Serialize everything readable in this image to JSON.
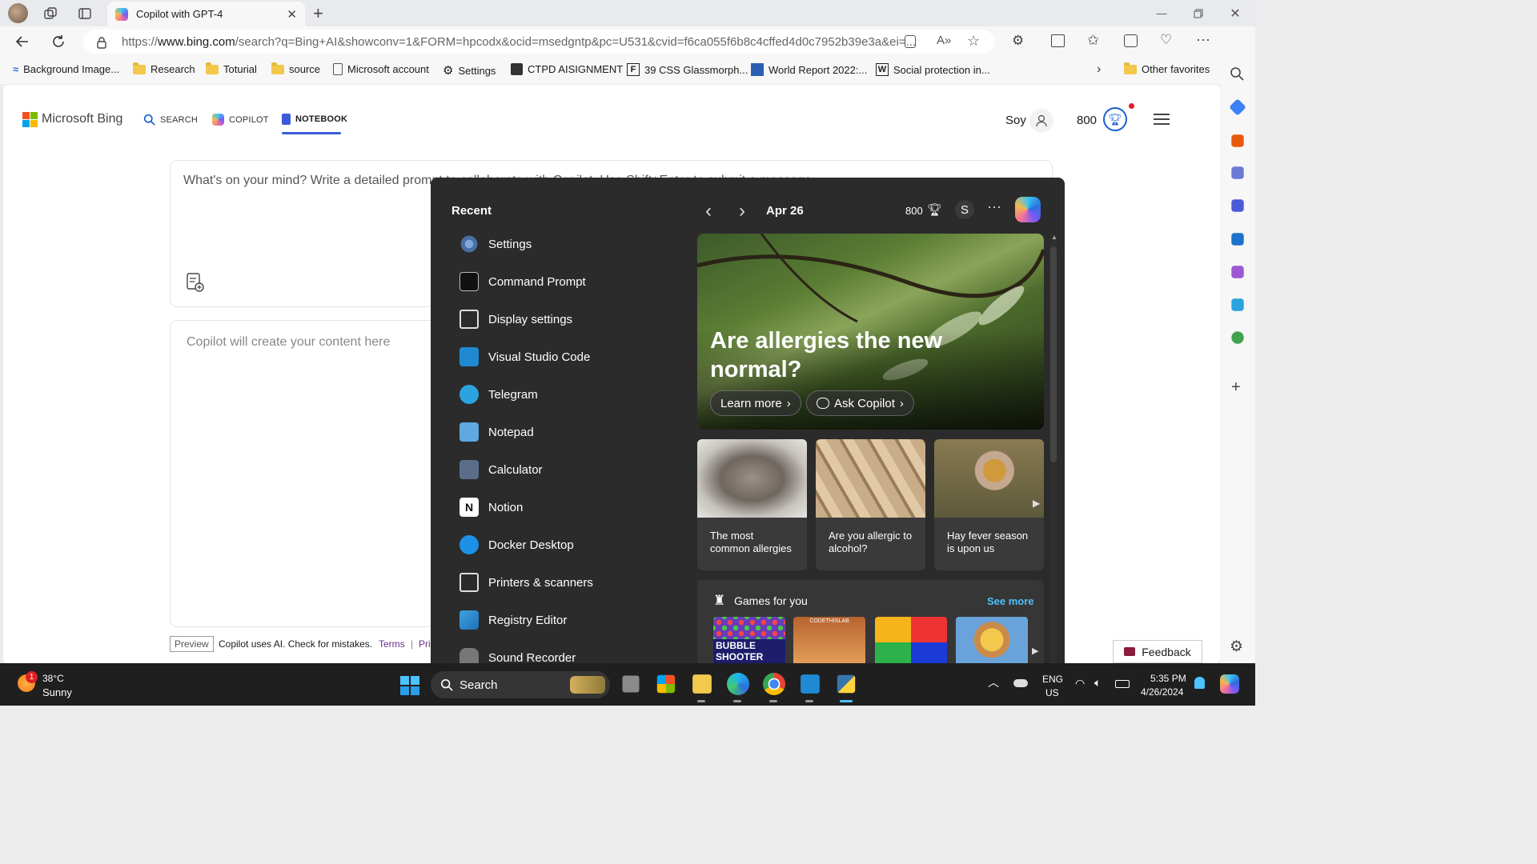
{
  "browser": {
    "tab_title": "Copilot with GPT-4",
    "url_prefix": "https://",
    "url_domain": "www.bing.com",
    "url_rest": "/search?q=Bing+AI&showconv=1&FORM=hpcodx&ocid=msedgntp&pc=U531&cvid=f6ca055f6b8c4cffed4d0c7952b39e3a&ei=...",
    "favorites": [
      "Background Image...",
      "Research",
      "Toturial",
      "source",
      "Microsoft account",
      "Settings",
      "CTPD AISIGNMENT",
      "39 CSS Glassmorph...",
      "World Report 2022:...",
      "Social protection in..."
    ],
    "other_favorites": "Other favorites"
  },
  "bing": {
    "logo": "Microsoft Bing",
    "nav": [
      "SEARCH",
      "COPILOT",
      "NOTEBOOK"
    ],
    "user": "Soy",
    "points": "800",
    "prompt_placeholder": "What's on your mind? Write a detailed prompt to collaborate with Copilot. Use Shift+Enter to submit a message.",
    "output_placeholder": "Copilot will create your content here",
    "preview": "Preview",
    "disclaimer": "Copilot uses AI. Check for mistakes.",
    "terms": "Terms",
    "privacy": "Pri",
    "feedback": "Feedback"
  },
  "start_menu": {
    "recent_label": "Recent",
    "date": "Apr 26",
    "points": "800",
    "avatar_letter": "S",
    "recent": [
      "Settings",
      "Command Prompt",
      "Display settings",
      "Visual Studio Code",
      "Telegram",
      "Notepad",
      "Calculator",
      "Notion",
      "Docker Desktop",
      "Printers & scanners",
      "Registry Editor",
      "Sound Recorder"
    ],
    "hero_title": "Are allergies the new normal?",
    "learn_more": "Learn more",
    "ask_copilot": "Ask Copilot",
    "cards": [
      "The most common allergies",
      "Are you allergic to alcohol?",
      "Hay fever season is upon us"
    ],
    "games_title": "Games for you",
    "see_more": "See more",
    "game_tile_text": "BUBBLE SHOOTER",
    "game_tile_text2": "CODETHISLAB"
  },
  "taskbar": {
    "temp": "38°C",
    "weather": "Sunny",
    "badge": "1",
    "search": "Search",
    "lang1": "ENG",
    "lang2": "US",
    "time": "5:35 PM",
    "date": "4/26/2024"
  },
  "colors": {
    "accent": "#1a73e8",
    "titlebar": "#e8eaed",
    "start_bg": "#2b2b2b",
    "taskbar": "#1f1f1f",
    "link_blue": "#4cc2ff"
  }
}
